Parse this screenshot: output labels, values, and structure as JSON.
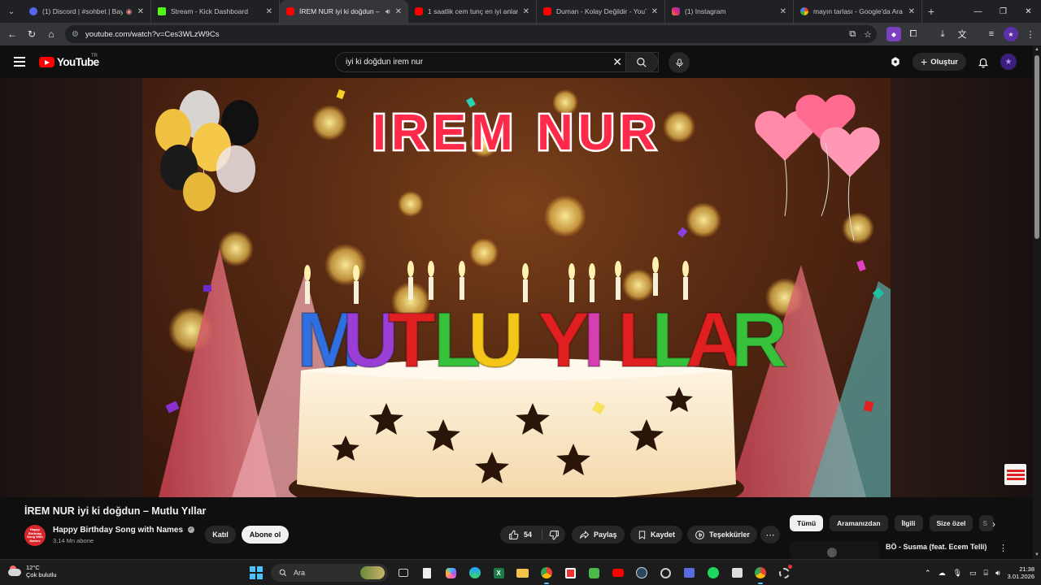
{
  "browser": {
    "tabs": [
      {
        "title": "(1) Discord | #sohbet | BayT",
        "favicon_color": "#5865f2",
        "active": false
      },
      {
        "title": "Stream - Kick Dashboard",
        "favicon_color": "#53fc18",
        "active": false
      },
      {
        "title": "İREM NUR iyi ki doğdun –",
        "favicon_color": "#ff0000",
        "active": true
      },
      {
        "title": "1 saatlik cem tunç en iyi anlar (",
        "favicon_color": "#ff0000",
        "active": false
      },
      {
        "title": "Duman - Kolay Değildir - YouTu",
        "favicon_color": "#ff0000",
        "active": false
      },
      {
        "title": "(1) Instagram",
        "favicon_color": "#e1306c",
        "active": false
      },
      {
        "title": "mayın tarlası - Google'da Ara",
        "favicon_color": "#4285f4",
        "active": false
      }
    ],
    "url": "youtube.com/watch?v=Ces3WLzW9Cs"
  },
  "youtube": {
    "logo_text": "YouTube",
    "country_code": "TR",
    "search_query": "iyi ki doğdun irem nur",
    "create_label": "Oluştur"
  },
  "video": {
    "title": "İREM NUR iyi ki doğdun – Mutlu Yıllar",
    "overlay_name": "IREM NUR",
    "overlay_greeting": "MUTLU YILLAR",
    "greeting_letters": [
      {
        "char": "M",
        "color": "#2f6fe0"
      },
      {
        "char": "U",
        "color": "#9a3fd6"
      },
      {
        "char": "T",
        "color": "#e02020"
      },
      {
        "char": "L",
        "color": "#38c23c"
      },
      {
        "char": "U",
        "color": "#f5c518"
      },
      {
        "char": "Y",
        "color": "#e02020"
      },
      {
        "char": "I",
        "color": "#d63fb0"
      },
      {
        "char": "L",
        "color": "#e02020"
      },
      {
        "char": "L",
        "color": "#38c23c"
      },
      {
        "char": "A",
        "color": "#e02020"
      },
      {
        "char": "R",
        "color": "#38c23c"
      }
    ]
  },
  "channel": {
    "name": "Happy Birthday Song with Names",
    "subscribers": "3,14 Mn abone",
    "avatar_text": "Happy Birthday Song With Names",
    "join_label": "Katıl",
    "subscribe_label": "Abone ol"
  },
  "actions": {
    "like_count": "54",
    "share_label": "Paylaş",
    "save_label": "Kaydet",
    "thanks_label": "Teşekkürler"
  },
  "chips": [
    "Tümü",
    "Aramanızdan",
    "İlgili",
    "Size özel",
    "S"
  ],
  "related": {
    "title": "BÖ - Susma (feat. Ecem Telli)"
  },
  "taskbar": {
    "weather_temp": "12°C",
    "weather_desc": "Çok bulutlu",
    "search_placeholder": "Ara",
    "time": "21:38",
    "date": "3.01.2026"
  }
}
